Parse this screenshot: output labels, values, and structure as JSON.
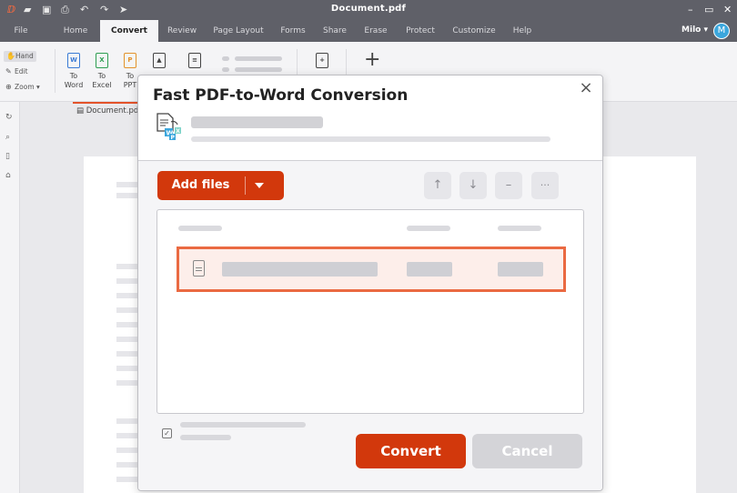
{
  "window": {
    "title": "Document.pdf",
    "minimize_glyph": "–",
    "maximize_glyph": "▭",
    "close_glyph": "✕"
  },
  "quick_access": [
    "folder-open-icon",
    "save-icon",
    "print-icon",
    "undo-icon",
    "redo-icon",
    "cursor-icon"
  ],
  "menu": {
    "items": [
      {
        "label": "File"
      },
      {
        "label": "Home"
      },
      {
        "label": "Convert"
      },
      {
        "label": "Review"
      },
      {
        "label": "Page Layout"
      },
      {
        "label": "Forms"
      },
      {
        "label": "Share"
      },
      {
        "label": "Erase"
      },
      {
        "label": "Protect"
      },
      {
        "label": "Customize"
      },
      {
        "label": "Help"
      }
    ],
    "active": "Convert",
    "user_name": "Milo ▾",
    "avatar_letter": "M"
  },
  "ribbon": {
    "mode_tools": [
      {
        "label": "Hand",
        "icon": "hand-icon"
      },
      {
        "label": "Edit",
        "icon": "edit-icon"
      },
      {
        "label": "Zoom ▾",
        "icon": "zoom-icon"
      }
    ],
    "convert_buttons": [
      {
        "line1": "To",
        "line2": "Word",
        "badge": "W"
      },
      {
        "line1": "To",
        "line2": "Excel",
        "badge": "X"
      },
      {
        "line1": "To",
        "line2": "PPT",
        "badge": "P"
      }
    ]
  },
  "document_tab": {
    "label": "Document.pdf"
  },
  "dialog": {
    "title": "Fast PDF-to-Word Conversion",
    "close_label": "×",
    "add_files_label": "Add files",
    "actions": [
      {
        "name": "move-up",
        "glyph": "↑"
      },
      {
        "name": "move-down",
        "glyph": "↓"
      },
      {
        "name": "remove",
        "glyph": "–"
      },
      {
        "name": "more",
        "glyph": "···"
      }
    ],
    "checkbox_glyph": "✓",
    "convert_label": "Convert",
    "cancel_label": "Cancel",
    "colors": {
      "accent": "#d2380c",
      "highlight_border": "#ea6a42",
      "highlight_fill": "#fdeeea",
      "disabled": "#d4d4d8"
    }
  }
}
